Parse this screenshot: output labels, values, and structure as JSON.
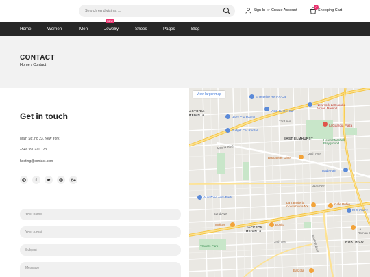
{
  "header": {
    "search_placeholder": "Search en divisima ...",
    "sign_in": "Sign In",
    "or": "or",
    "create_account": "Create Account",
    "cart_count": "0",
    "cart_label": "Shopping Cart"
  },
  "nav": {
    "items": [
      "Home",
      "Women",
      "Men",
      "Jewelry",
      "Shoes",
      "Pages",
      "Blog"
    ],
    "new_badge": "NEW"
  },
  "page_header": {
    "title": "CONTACT",
    "breadcrumb": "Home / Contact"
  },
  "contact": {
    "heading": "Get in touch",
    "address": "Main Str, no 23, New York",
    "phone": "+546 990221 123",
    "email": "hosting@contact.com",
    "socials": [
      "pinterest-icon",
      "facebook-icon",
      "twitter-icon",
      "dribbble-icon",
      "behance-icon"
    ]
  },
  "form": {
    "name_placeholder": "Your name",
    "email_placeholder": "Your e-mail",
    "subject_placeholder": "Subject",
    "message_placeholder": "Message"
  },
  "map": {
    "larger_map": "View larger map",
    "labels": {
      "astoria_heights": "ASTORIA\nHEIGHTS",
      "east_elmhurst": "EAST ELMHURST",
      "jackson_heights": "JACKSON\nHEIGHTS",
      "north_corona": "NORTH CO",
      "enterprise": "Enterprise Rent-A-Car",
      "laguardia_marriott": "New York LaGuardia\nAirport Marriott",
      "ace_rent": "ACE Rent A Car",
      "hertz": "Hertz Car Rental",
      "budget": "Budget Car Rental",
      "laguardia_plaza": "LaGuardia Plaza",
      "helen_marshall": "Helen Marshall\nPlayground",
      "buccaneer": "Buccaneer Diner",
      "trade_fair": "Trade Fair",
      "autozone": "AutoZone Auto Parts",
      "la_tamaleria": "La Tamaleria\nColombiana NY",
      "cafe_rubio": "Cafe Rubio",
      "pls_check": "PLS Check",
      "mojitos": "Mojitos",
      "bonito": "Bonito",
      "travers_park": "Travers Park",
      "la_roman": "La\nRoman Ca",
      "barzola": "Barzola",
      "ave_23": "23rd Ave",
      "ave_25": "25th Ave",
      "ave_31": "31st Ave",
      "ave_32": "32nd Ave",
      "ave_34": "34th Ave",
      "astoria_blvd": "Astoria Blvd",
      "junction_blvd": "Junction Blvd"
    }
  }
}
